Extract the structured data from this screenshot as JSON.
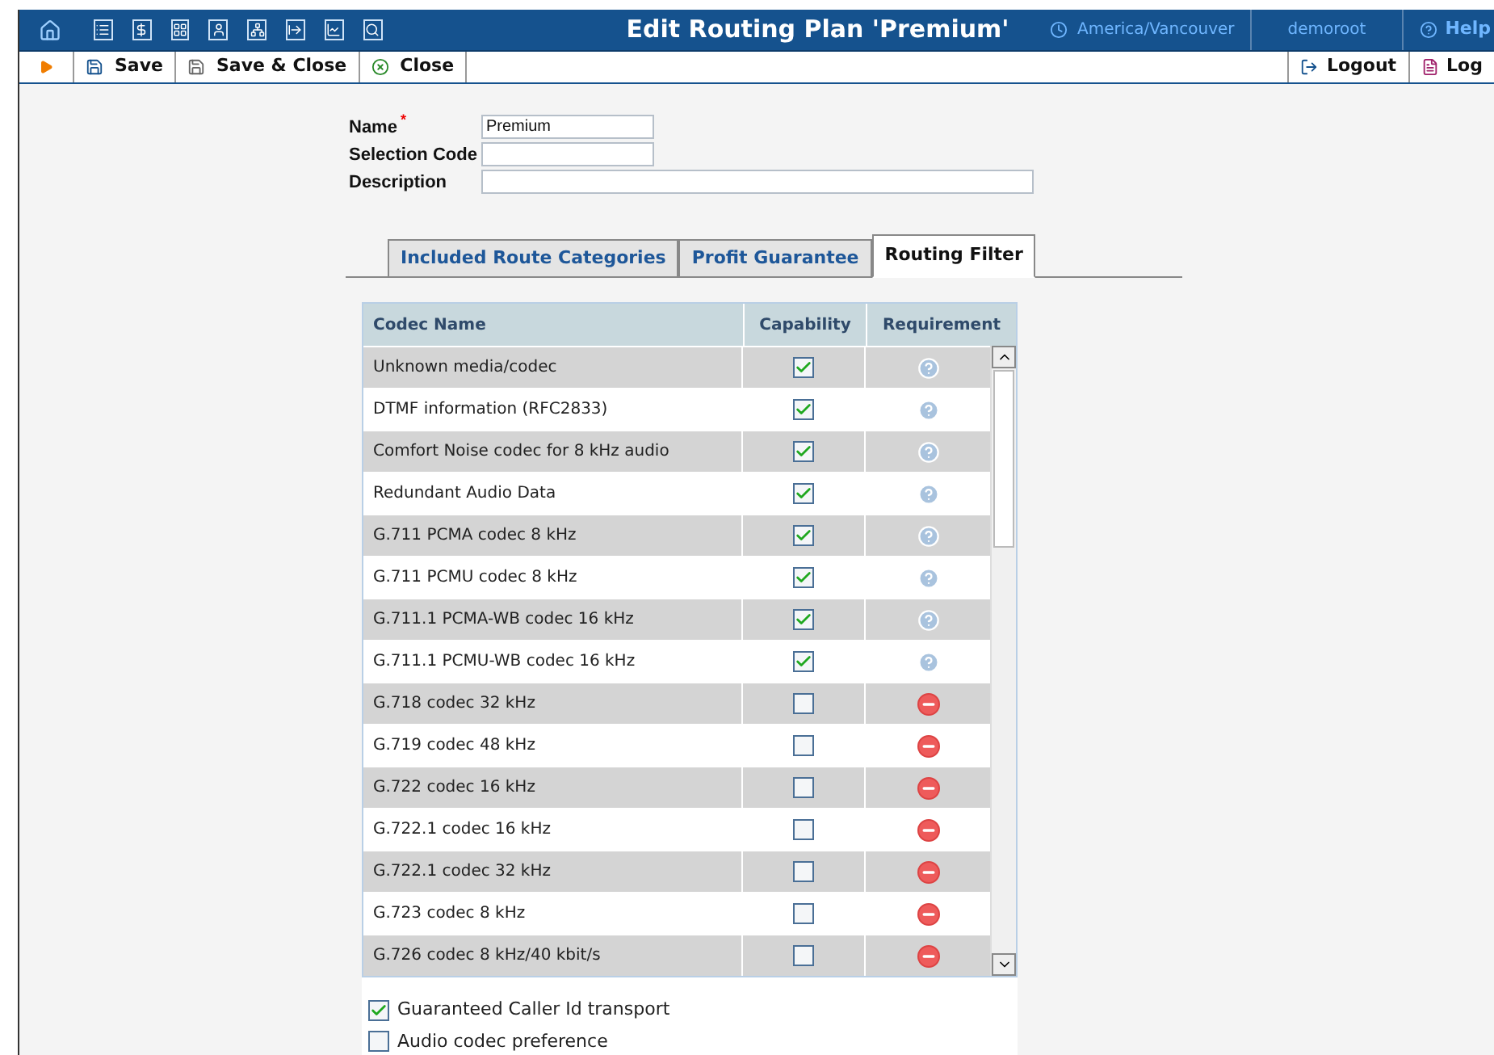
{
  "header": {
    "title": "Edit Routing Plan 'Premium'",
    "timezone": "America/Vancouver",
    "user": "demoroot",
    "help": "Help"
  },
  "toolbar": {
    "buttons": [
      {
        "kind": "save",
        "label": "Save"
      },
      {
        "kind": "save_close",
        "label": "Save & Close"
      },
      {
        "kind": "close",
        "label": "Close"
      }
    ],
    "right": [
      {
        "kind": "logout",
        "label": "Logout"
      },
      {
        "kind": "log",
        "label": "Log"
      }
    ]
  },
  "form": {
    "fields": [
      {
        "label": "Name",
        "marker": "*",
        "value": "Premium"
      },
      {
        "label": "Selection Code"
      },
      {
        "label": "Description"
      }
    ]
  },
  "tabs": [
    {
      "label": "Included Route Categories",
      "selected": false
    },
    {
      "label": "Profit Guarantee",
      "selected": false
    },
    {
      "label": "Routing Filter",
      "selected": true
    }
  ],
  "table": {
    "columns": [
      "Codec Name",
      "Capability",
      "Requirement"
    ],
    "rows": [
      {
        "name": "Unknown media/codec",
        "capability": true,
        "kind": "optional"
      },
      {
        "name": "DTMF information (RFC2833)",
        "capability": true,
        "kind": "optional"
      },
      {
        "name": "Comfort Noise codec for 8 kHz audio",
        "capability": true,
        "kind": "optional"
      },
      {
        "name": "Redundant Audio Data",
        "capability": true,
        "kind": "optional"
      },
      {
        "name": "G.711 PCMA codec 8 kHz",
        "capability": true,
        "kind": "optional"
      },
      {
        "name": "G.711 PCMU codec 8 kHz",
        "capability": true,
        "kind": "optional"
      },
      {
        "name": "G.711.1 PCMA-WB codec 16 kHz",
        "capability": true,
        "kind": "optional"
      },
      {
        "name": "G.711.1 PCMU-WB codec 16 kHz",
        "capability": true,
        "kind": "optional"
      },
      {
        "name": "G.718 codec 32 kHz",
        "capability": false,
        "kind": "forbidden"
      },
      {
        "name": "G.719 codec 48 kHz",
        "capability": false,
        "kind": "forbidden"
      },
      {
        "name": "G.722 codec 16 kHz",
        "capability": false,
        "kind": "forbidden"
      },
      {
        "name": "G.722.1 codec 16 kHz",
        "capability": false,
        "kind": "forbidden"
      },
      {
        "name": "G.722.1 codec 32 kHz",
        "capability": false,
        "kind": "forbidden"
      },
      {
        "name": "G.723 codec 8 kHz",
        "capability": false,
        "kind": "forbidden"
      },
      {
        "name": "G.726 codec 8 kHz/40 kbit/s",
        "capability": false,
        "kind": "forbidden"
      }
    ]
  },
  "options": [
    {
      "label": "Guaranteed Caller Id transport",
      "checked": true
    },
    {
      "label": "Audio codec preference",
      "checked": false
    }
  ]
}
